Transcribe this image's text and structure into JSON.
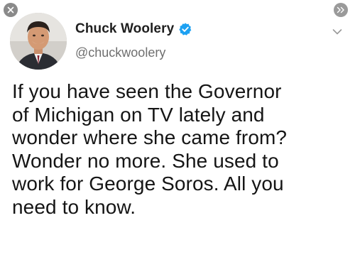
{
  "author": {
    "display_name": "Chuck Woolery",
    "handle": "@chuckwoolery",
    "verified": true
  },
  "tweet": {
    "lines": [
      "If you have seen the Governor",
      "of Michigan on TV lately and",
      "wonder where she came from?",
      "Wonder no more. She used to",
      "work for George Soros. All you",
      "need to know."
    ]
  },
  "icons": {
    "close": "close-icon",
    "expand": "double-chevron-right-icon",
    "more": "chevron-down-icon",
    "verified": "verified-badge-icon"
  },
  "colors": {
    "verified_blue": "#1da1f2",
    "handle_gray": "#6f6f6f",
    "text": "#151515"
  }
}
